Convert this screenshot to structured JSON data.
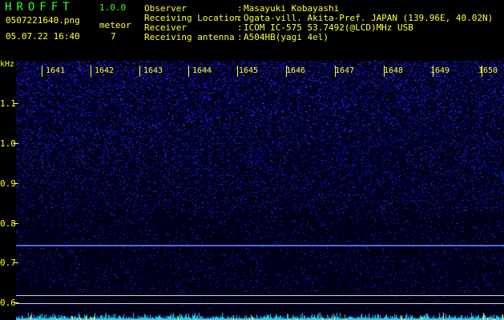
{
  "app": {
    "title": "HROFFT",
    "version": "1.0.0"
  },
  "file": {
    "name": "0507221640.png",
    "datetime": "05.07.22 16:40"
  },
  "meteor": {
    "label": "meteor",
    "count": "7"
  },
  "info": [
    {
      "label": "Observer",
      "value": "Masayuki Kobayashi"
    },
    {
      "label": "Receiving Location",
      "value": "Ogata-vill. Akita-Pref. JAPAN (139.96E, 40.02N)"
    },
    {
      "label": "Receiver",
      "value": "ICOM IC-575 53.7492(@LCD)MHz USB"
    },
    {
      "label": "Receiving antenna",
      "value": "A504HB(yagi 4el)"
    }
  ],
  "axis": {
    "y_unit": "kHz",
    "y_ticks": [
      "1.1",
      "1.0",
      "0.9",
      "0.8",
      "0.7",
      "0.6"
    ],
    "x_ticks": [
      "1641",
      "1642",
      "1643",
      "1644",
      "1645",
      "1646",
      "1647",
      "1648",
      "1649",
      "1650"
    ]
  },
  "colors": {
    "label": "#ffff33",
    "title": "#33ff33",
    "signal": "#2244ff",
    "background": "#000000"
  }
}
